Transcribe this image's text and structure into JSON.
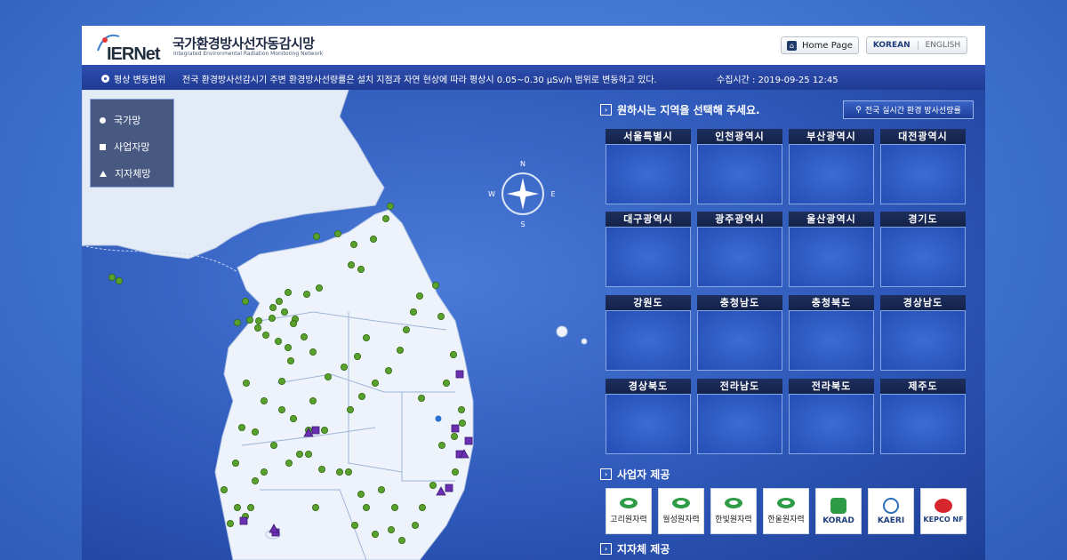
{
  "header": {
    "logo_text": "IERNet",
    "title_ko": "국가환경방사선자동감시망",
    "title_en": "Integrated Environmental Radiation Monitoring Network",
    "home_label": "Home Page",
    "lang_korean": "KOREAN",
    "lang_english": "ENGLISH"
  },
  "infobar": {
    "label": "평상 변동범위",
    "message": "전국 환경방사선감시기 주변 환경방사선량률은 설치 지점과 자연 현상에 따라 평상시 0.05~0.30 μSv/h 범위로 변동하고 있다.",
    "time": "수집시간 : 2019-09-25 12:45"
  },
  "legend": {
    "items": [
      "국가망",
      "사업자망",
      "지자체망"
    ]
  },
  "compass": {
    "n": "N",
    "s": "S",
    "e": "E",
    "w": "W"
  },
  "right": {
    "select_title": "원하시는 지역을 선택해 주세요.",
    "realtime_button": "전국 실시간 환경 방사선량률",
    "regions": [
      "서울특별시",
      "인천광역시",
      "부산광역시",
      "대전광역시",
      "대구광역시",
      "광주광역시",
      "울산광역시",
      "경기도",
      "강원도",
      "충청남도",
      "충청북도",
      "경상남도",
      "경상북도",
      "전라남도",
      "전라북도",
      "제주도"
    ],
    "operator_title": "사업자 제공",
    "operators": [
      "고리원자력",
      "월성원자력",
      "한빛원자력",
      "한울원자력",
      "KORAD",
      "KAERI",
      "KEPCO NF"
    ],
    "local_title": "지자체 제공"
  },
  "colors": {
    "national_station": "#5aa02c",
    "operator_station": "#6a2eb0",
    "header_bar": "#1f3a92",
    "panel_bg": "#2d57b8"
  }
}
